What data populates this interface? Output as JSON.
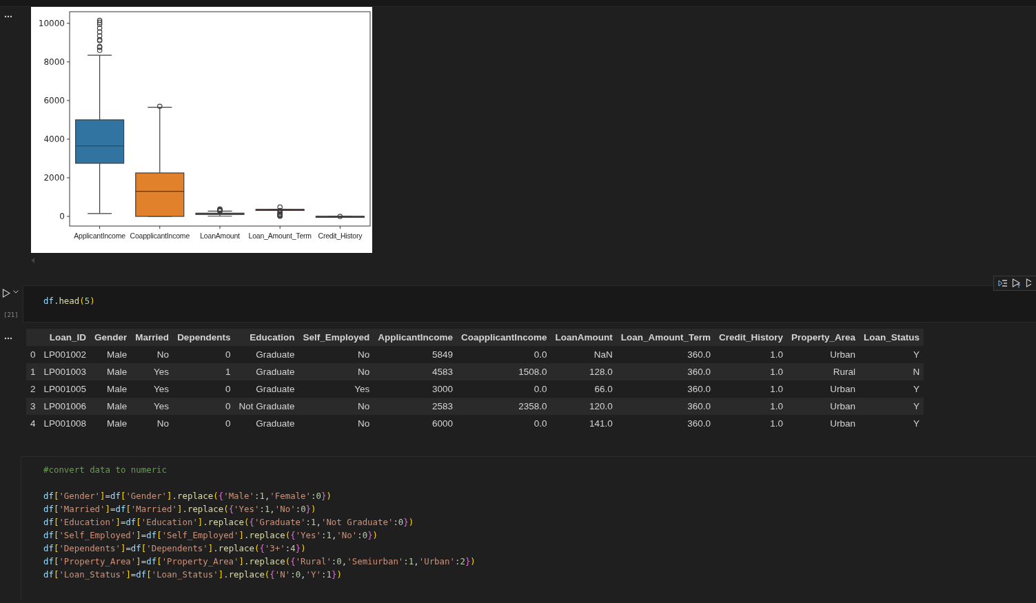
{
  "output_chart": {
    "y_tick_labels": [
      "10000",
      "8000",
      "6000",
      "4000",
      "2000",
      "0"
    ],
    "x_tick_labels": [
      "ApplicantIncome",
      "CoapplicantIncome",
      "LoanAmount",
      "Loan_Amount_Term",
      "Credit_History"
    ]
  },
  "cell": {
    "execution_count": "[21]",
    "code": "df.head(5)"
  },
  "table": {
    "columns": [
      "Loan_ID",
      "Gender",
      "Married",
      "Dependents",
      "Education",
      "Self_Employed",
      "ApplicantIncome",
      "CoapplicantIncome",
      "LoanAmount",
      "Loan_Amount_Term",
      "Credit_History",
      "Property_Area",
      "Loan_Status"
    ],
    "rows": [
      {
        "index": "0",
        "cells": [
          "LP001002",
          "Male",
          "No",
          "0",
          "Graduate",
          "No",
          "5849",
          "0.0",
          "NaN",
          "360.0",
          "1.0",
          "Urban",
          "Y"
        ]
      },
      {
        "index": "1",
        "cells": [
          "LP001003",
          "Male",
          "Yes",
          "1",
          "Graduate",
          "No",
          "4583",
          "1508.0",
          "128.0",
          "360.0",
          "1.0",
          "Rural",
          "N"
        ]
      },
      {
        "index": "2",
        "cells": [
          "LP001005",
          "Male",
          "Yes",
          "0",
          "Graduate",
          "Yes",
          "3000",
          "0.0",
          "66.0",
          "360.0",
          "1.0",
          "Urban",
          "Y"
        ]
      },
      {
        "index": "3",
        "cells": [
          "LP001006",
          "Male",
          "Yes",
          "0",
          "Not Graduate",
          "No",
          "2583",
          "2358.0",
          "120.0",
          "360.0",
          "1.0",
          "Urban",
          "Y"
        ]
      },
      {
        "index": "4",
        "cells": [
          "LP001008",
          "Male",
          "No",
          "0",
          "Graduate",
          "No",
          "6000",
          "0.0",
          "141.0",
          "360.0",
          "1.0",
          "Urban",
          "Y"
        ]
      }
    ]
  },
  "code_cell": {
    "comment": "#convert data to numeric",
    "lines": [
      "df['Gender']=df['Gender'].replace({'Male':1,'Female':0})",
      "df['Married']=df['Married'].replace({'Yes':1,'No':0})",
      "df['Education']=df['Education'].replace({'Graduate':1,'Not Graduate':0})",
      "df['Self_Employed']=df['Self_Employed'].replace({'Yes':1,'No':0})",
      "df['Dependents']=df['Dependents'].replace({'3+':4})",
      "df['Property_Area']=df['Property_Area'].replace({'Rural':0,'Semiurban':1,'Urban':2})",
      "df['Loan_Status']=df['Loan_Status'].replace({'N':0,'Y':1})"
    ]
  }
}
